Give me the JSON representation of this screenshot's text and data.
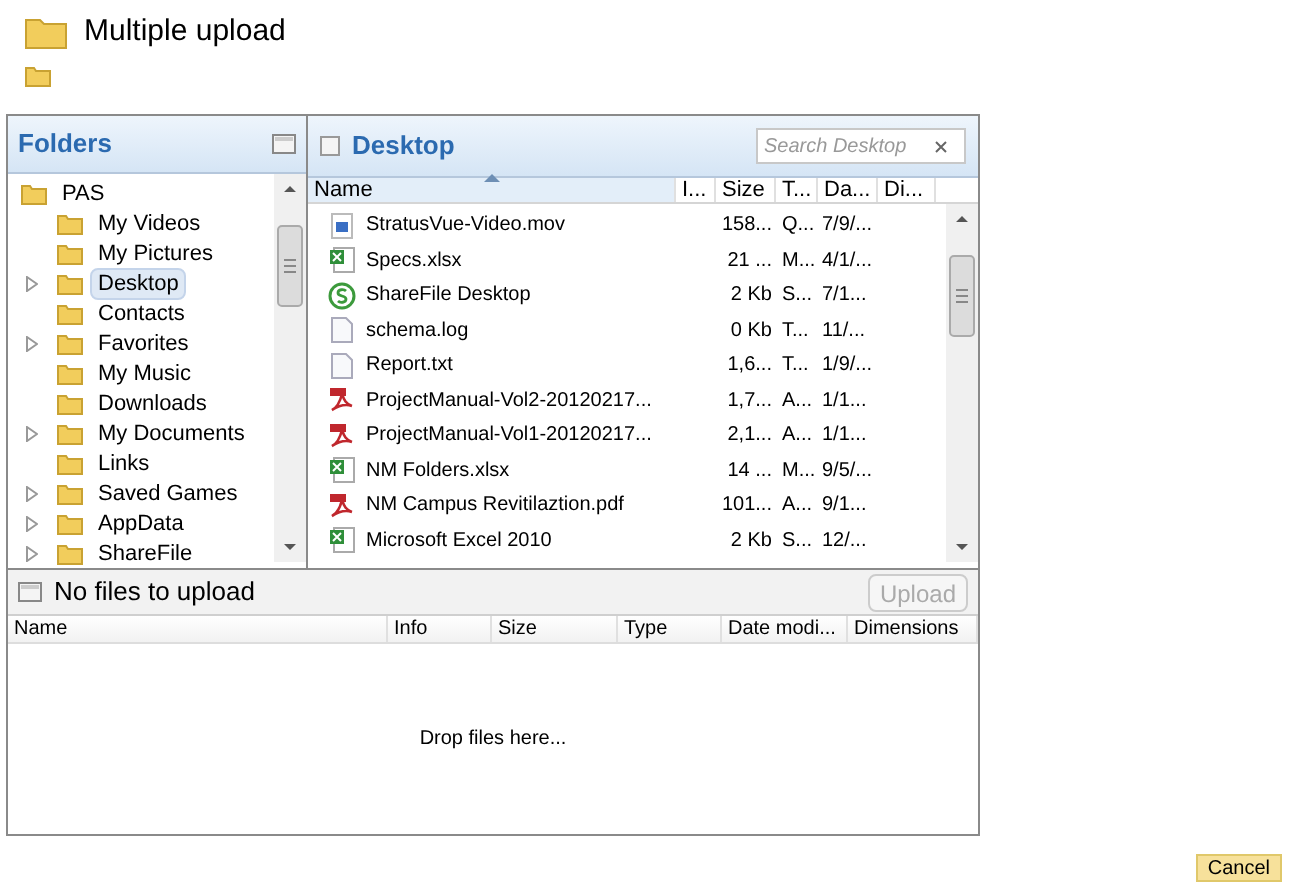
{
  "window": {
    "title": "Multiple upload"
  },
  "folders": {
    "title": "Folders",
    "tree": [
      {
        "label": "PAS",
        "selected": false,
        "children": [
          {
            "label": "My Videos",
            "selected": false,
            "has_children": false
          },
          {
            "label": "My Pictures",
            "selected": false,
            "has_children": false
          },
          {
            "label": "Desktop",
            "selected": true,
            "has_children": true
          },
          {
            "label": "Contacts",
            "selected": false,
            "has_children": false
          },
          {
            "label": "Favorites",
            "selected": false,
            "has_children": true
          },
          {
            "label": "My Music",
            "selected": false,
            "has_children": false
          },
          {
            "label": "Downloads",
            "selected": false,
            "has_children": false
          },
          {
            "label": "My Documents",
            "selected": false,
            "has_children": true
          },
          {
            "label": "Links",
            "selected": false,
            "has_children": false
          },
          {
            "label": "Saved Games",
            "selected": false,
            "has_children": true
          },
          {
            "label": "AppData",
            "selected": false,
            "has_children": true
          },
          {
            "label": "ShareFile",
            "selected": false,
            "has_children": true
          }
        ]
      }
    ]
  },
  "browser": {
    "title": "Desktop",
    "checked": false,
    "search": {
      "placeholder": "Search Desktop"
    },
    "columns": [
      "Name",
      "I...",
      "Size",
      "T...",
      "Da...",
      "Di..."
    ],
    "rows": [
      {
        "kind": "video",
        "name": "StratusVue-Video.mov",
        "size": "158...",
        "type": "Q...",
        "date": "7/9/..."
      },
      {
        "kind": "excel",
        "name": "Specs.xlsx",
        "size": "21 ...",
        "type": "M...",
        "date": "4/1/..."
      },
      {
        "kind": "sharefile",
        "name": "ShareFile Desktop",
        "size": "2 Kb",
        "type": "S...",
        "date": "7/1..."
      },
      {
        "kind": "text",
        "name": "schema.log",
        "size": "0 Kb",
        "type": "T...",
        "date": "11/..."
      },
      {
        "kind": "text",
        "name": "Report.txt",
        "size": "1,6...",
        "type": "T...",
        "date": "1/9/..."
      },
      {
        "kind": "pdf",
        "name": "ProjectManual-Vol2-20120217...",
        "size": "1,7...",
        "type": "A...",
        "date": "1/1..."
      },
      {
        "kind": "pdf",
        "name": "ProjectManual-Vol1-20120217...",
        "size": "2,1...",
        "type": "A...",
        "date": "1/1..."
      },
      {
        "kind": "excel",
        "name": "NM Folders.xlsx",
        "size": "14 ...",
        "type": "M...",
        "date": "9/5/..."
      },
      {
        "kind": "pdf",
        "name": "NM Campus Revitilaztion.pdf",
        "size": "101...",
        "type": "A...",
        "date": "9/1..."
      },
      {
        "kind": "excel",
        "name": "Microsoft Excel 2010",
        "size": "2 Kb",
        "type": "S...",
        "date": "12/..."
      }
    ]
  },
  "upload": {
    "status": "No files to upload",
    "button": {
      "label": "Upload",
      "disabled": true
    },
    "columns": [
      "Name",
      "Info",
      "Size",
      "Type",
      "Date modi...",
      "Dimensions"
    ],
    "drop_hint": "Drop files here..."
  },
  "buttons": [
    {
      "label": "Cancel"
    }
  ]
}
